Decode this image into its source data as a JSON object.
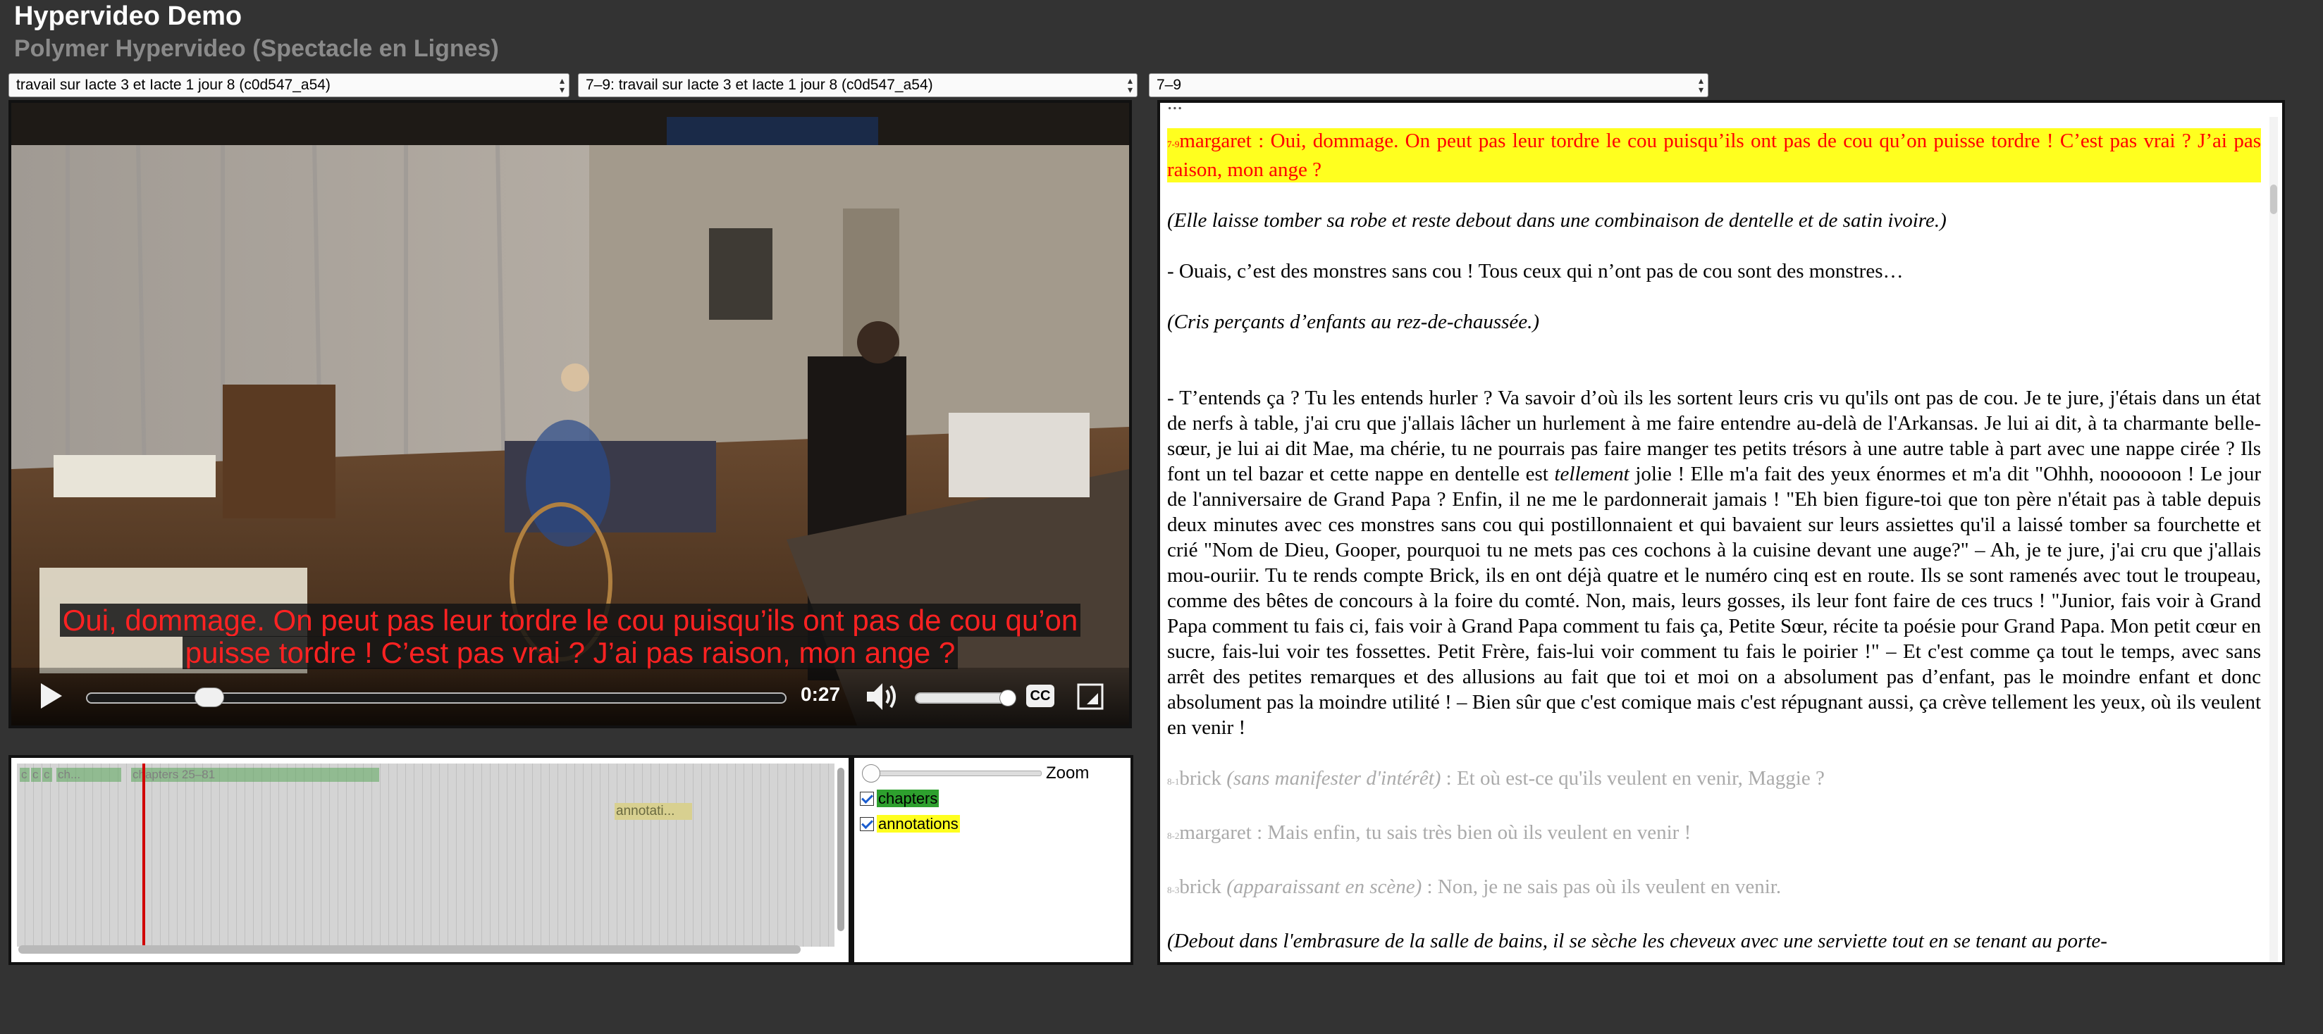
{
  "app": {
    "title": "Hypervideo Demo",
    "subtitle": "Polymer Hypervideo (Spectacle en Lignes)"
  },
  "selectors": {
    "video_select": "travail sur Iacte 3 et Iacte 1 jour 8 (c0d547_a54)",
    "chapter_select": "7–9: travail sur Iacte 3 et Iacte 1 jour 8 (c0d547_a54)",
    "scene_select": "7–9"
  },
  "video": {
    "subtitle_line1": "Oui, dommage. On peut pas leur tordre le cou puisqu’ils ont pas de cou qu’on",
    "subtitle_line2": "puisse tordre ! C’est pas vrai ? J’ai pas raison, mon ange ?",
    "current_time": "0:27",
    "progress_fraction": 0.16,
    "volume_fraction": 1.0,
    "cc_label": "CC",
    "icons": [
      "play-icon",
      "volume-icon",
      "closed-captions-icon",
      "fullscreen-icon"
    ]
  },
  "timeline": {
    "chapters": [
      {
        "label": "c"
      },
      {
        "label": "c"
      },
      {
        "label": "c"
      },
      {
        "label": "ch..."
      },
      {
        "label": "chapters 25–81"
      }
    ],
    "annotation": "annotati...",
    "colors": {
      "chapter": "#5aa55a",
      "annotation": "#d8d090",
      "cursor": "#d10000"
    }
  },
  "layers": {
    "zoom_label": "Zoom",
    "items": [
      {
        "label": "chapters",
        "checked": true,
        "color": "#2ea02e"
      },
      {
        "label": "annotations",
        "checked": true,
        "color": "#ffff1f"
      }
    ]
  },
  "transcript": {
    "cut_top": "...",
    "line1_num": "7-9",
    "line1": "margaret : Oui, dommage. On peut pas leur tordre le cou puisqu’ils ont pas de cou qu’on puisse tordre ! C’est pas vrai ? J’ai pas raison, mon ange ?",
    "stage1": "(Elle laisse tomber sa robe et reste debout dans une combinaison de dentelle et de satin ivoire.)",
    "line2": "- Ouais, c’est des monstres sans cou ! Tous ceux qui n’ont pas de cou sont des monstres…",
    "stage2": "(Cris perçants d’enfants au rez-de-chaussée.)",
    "para_a": "- T’entends ça ? Tu les entends hurler ? Va savoir d’où ils les sortent leurs cris vu qu'ils ont pas de cou. Je te jure, j'étais dans un état de nerfs à table, j'ai cru que j'allais lâcher un hurlement à me faire entendre au-delà de l'Arkansas. Je lui ai dit, à ta charmante belle-sœur, je lui ai dit Mae, ma chérie, tu ne pourrais pas faire manger tes petits trésors à une autre table à part avec une nappe cirée ? Ils font un tel bazar et cette nappe en dentelle est",
    "para_em": "tellement",
    "para_b": "jolie ! Elle m'a fait des yeux énormes et m'a dit \"Ohhh, noooooon ! Le jour de l'anniversaire de Grand Papa ? Enfin, il ne me le pardonnerait jamais ! \"Eh bien figure-toi que ton père n'était pas à table depuis deux minutes avec ces monstres sans cou qui postillonnaient et qui bavaient sur leurs assiettes qu'il a laissé tomber sa fourchette et crié \"Nom de Dieu, Gooper, pourquoi tu ne mets pas ces cochons à la cuisine devant une auge?\" – Ah, je te jure, j'ai cru que j'allais mou-ouriir. Tu te rends compte Brick, ils en ont déjà quatre et le numéro cinq est en route. Ils se sont ramenés avec tout le troupeau, comme des bêtes de concours à la foire du comté. Non, mais, leurs gosses, ils leur font faire de ces trucs ! \"Junior, fais voir à Grand Papa comment tu fais ci, fais voir à Grand Papa comment tu fais ça, Petite Sœur, récite ta poésie pour Grand Papa. Mon petit cœur en sucre, fais-lui voir tes fossettes. Petit Frère, fais-lui voir comment tu fais le poirier !\" – Et c'est comme ça tout le temps, avec sans arrêt des petites remarques et des allusions au fait que toi et moi on a absolument pas d’enfant, pas le moindre enfant et donc absolument pas la moindre utilité ! – Bien sûr que c'est comique mais c'est répugnant aussi, ça crève tellement les yeux, où ils veulent en venir !",
    "next1_num": "8-1",
    "next1_name": "brick",
    "next1_stage": "(sans manifester d'intérêt)",
    "next1_text": ": Et où est-ce qu'ils veulent en venir, Maggie ?",
    "next2_num": "8-2",
    "next2": "margaret : Mais enfin, tu sais très bien où ils veulent en venir !",
    "next3_num": "8-3",
    "next3_name": "brick",
    "next3_stage": "(apparaissant en scène)",
    "next3_text": ": Non, je ne sais pas où ils veulent en venir.",
    "stage3": "(Debout dans l'embrasure de la salle de bains, il se sèche les cheveux avec une serviette tout en se tenant au porte-"
  }
}
